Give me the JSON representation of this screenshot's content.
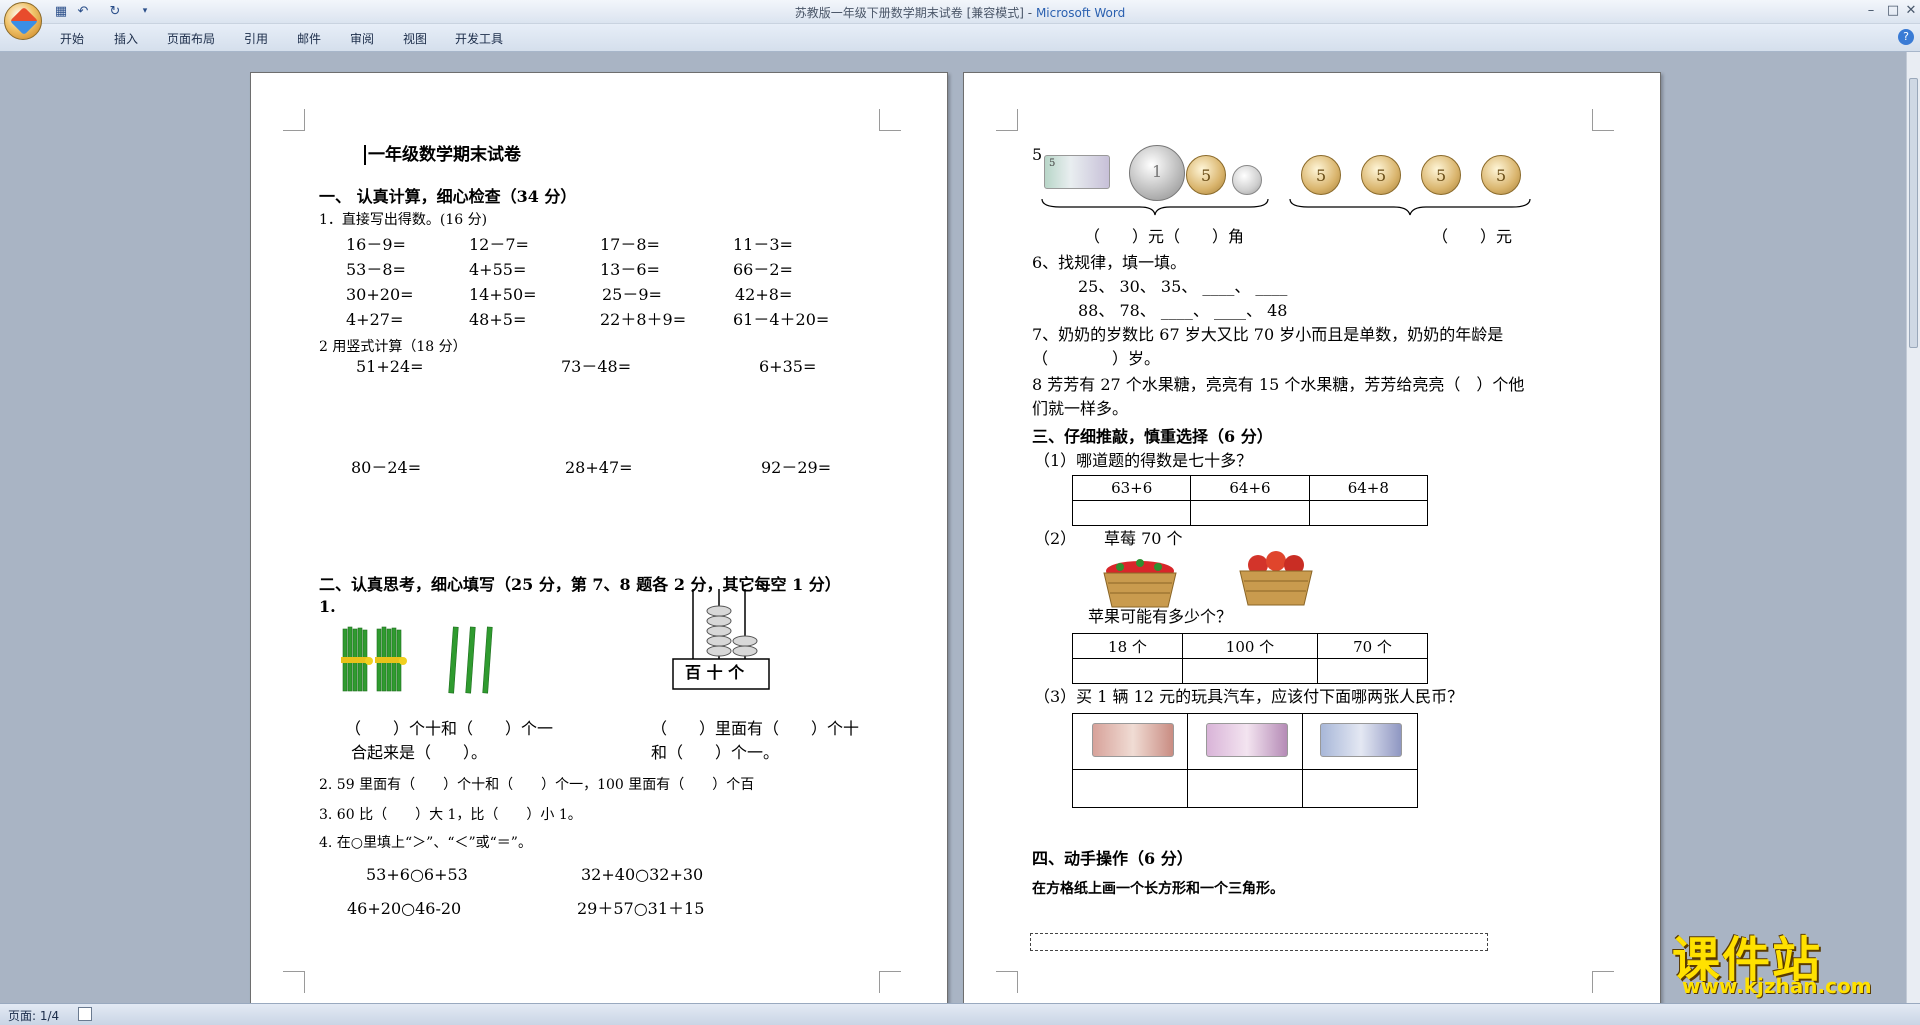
{
  "window": {
    "title": "苏教版一年级下册数学期末试卷 [兼容模式] -",
    "app_name": "Microsoft Word"
  },
  "quick_access": {
    "save_icon": "save-icon",
    "undo_icon": "undo-icon",
    "redo_icon": "redo-icon",
    "customize_icon": "dropdown-icon"
  },
  "ribbon": {
    "tabs": [
      "开始",
      "插入",
      "页面布局",
      "引用",
      "邮件",
      "审阅",
      "视图",
      "开发工具"
    ]
  },
  "status": {
    "page": "页面: 1/4"
  },
  "watermark": {
    "site_name": "课件站",
    "site_url": "www.kjzhan.com"
  },
  "left_page": {
    "title": "一年级数学期末试卷",
    "sec1": "一、  认真计算，细心检查（34 分）",
    "q1": "1．直接写出得数。(16 分)",
    "row1": [
      "16－9=",
      "12－7=",
      "17－8=",
      "11－3="
    ],
    "row2": [
      "53－8=",
      "4+55=",
      "13－6=",
      "66－2="
    ],
    "row3": [
      "30+20=",
      "14+50=",
      "25－9=",
      "42+8="
    ],
    "row4": [
      "4+27=",
      "48+5=",
      "22＋8＋9=",
      "61－4＋20="
    ],
    "q2": "2 用竖式计算（18 分）",
    "v1": [
      "51+24=",
      "73－48=",
      "6+35="
    ],
    "v2": [
      "80－24=",
      "28+47=",
      "92－29="
    ],
    "sec2": "二、认真思考，细心填写（25 分，第 7、8 题各 2 分，其它每空 1 分）",
    "q2_1": "1.",
    "abacus": "百 十 个",
    "fill1a": "（　　）个十和（　　）个一",
    "fill1b": "合起来是（　　）。",
    "fill1c": "（　　）里面有（　　）个十",
    "fill1d": "和（　　）个一。",
    "q2_2": "2. 59 里面有（　　）个十和（　　）个一，100 里面有（　　）个百",
    "q2_3": "3. 60 比（　　）大 1，比（　　）小 1。",
    "q2_4": "4. 在○里填上“＞”、“＜”或“＝”。",
    "cmp1": "53+6○6+53",
    "cmp2": "32+40○32+30",
    "cmp3": "46+20○46-20",
    "cmp4": "29＋57○31＋15"
  },
  "right_page": {
    "q5": "5",
    "bill_label": "5",
    "coin_5": "5",
    "coin_1": "1",
    "money_a": "（　　）元（　　）角",
    "money_b": "（　　）元",
    "q6": "6、找规律，填一填。",
    "seq1": "25、  30、  35、  ____、 ____",
    "seq2": "88、  78、  ____、  ____、  48",
    "q7a": "7、奶奶的岁数比 67 岁大又比 70 岁小而且是单数，奶奶的年龄是",
    "q7b": "（　　　　）岁。",
    "q8a": "8 芳芳有 27 个水果糖，亮亮有 15 个水果糖，芳芳给亮亮（　）个他",
    "q8b": "们就一样多。",
    "sec3": "三、仔细推敲，慎重选择（6 分）",
    "c1": "（1）哪道题的得数是七十多？",
    "c1_opts": [
      "63+6",
      "64+6",
      "64+8"
    ],
    "c2a": "（2）",
    "c2b": "草莓 70 个",
    "c2c": "苹果可能有多少个？",
    "c2_opts": [
      "18 个",
      "100 个",
      "70 个"
    ],
    "c3": "（3）买 1 辆 12 元的玩具汽车，应该付下面哪两张人民币？",
    "sec4": "四、动手操作（6 分）",
    "draw": "在方格纸上画一个长方形和一个三角形。"
  }
}
